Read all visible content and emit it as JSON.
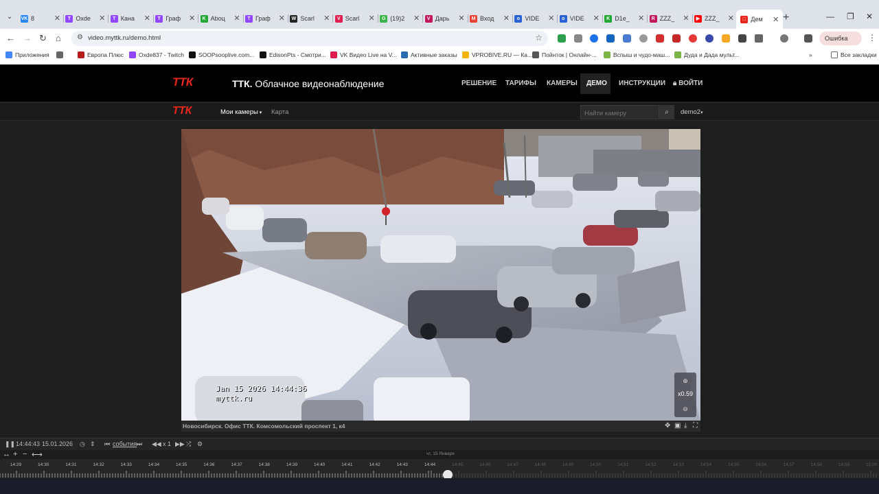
{
  "browser": {
    "tabs": [
      {
        "label": "8",
        "fav": "VK",
        "color": "#2787f5"
      },
      {
        "label": "Oxdе",
        "fav": "T",
        "color": "#9146ff"
      },
      {
        "label": "Кана",
        "fav": "T",
        "color": "#9146ff"
      },
      {
        "label": "Граф",
        "fav": "T",
        "color": "#9146ff"
      },
      {
        "label": "Aboц",
        "fav": "K",
        "color": "#22a833"
      },
      {
        "label": "Граф",
        "fav": "T",
        "color": "#9146ff"
      },
      {
        "label": "Scarl",
        "fav": "W",
        "color": "#222"
      },
      {
        "label": "Scarl",
        "fav": "V",
        "color": "#e01b4f"
      },
      {
        "label": "(19)2",
        "fav": "G",
        "color": "#3bb54a"
      },
      {
        "label": "Дарь",
        "fav": "V",
        "color": "#c2185b"
      },
      {
        "label": "Вход",
        "fav": "M",
        "color": "#ea4335"
      },
      {
        "label": "VIDE",
        "fav": "o",
        "color": "#2a62d5"
      },
      {
        "label": "VIDE",
        "fav": "o",
        "color": "#2a62d5"
      },
      {
        "label": "D1e_",
        "fav": "K",
        "color": "#22a833"
      },
      {
        "label": "ZZZ_",
        "fav": "R",
        "color": "#c2185b"
      },
      {
        "label": "ZZZ_",
        "fav": "▶",
        "color": "#ff0000"
      },
      {
        "label": "Дем",
        "fav": "□",
        "color": "#e8261c"
      }
    ],
    "url": "video.myttk.ru/demo.html",
    "error_button": "Ошибка",
    "bookmarks": [
      {
        "label": "Приложения",
        "color": "#4285f4"
      },
      {
        "label": "",
        "color": "#666"
      },
      {
        "label": "Европа Плюс",
        "color": "#b71c1c"
      },
      {
        "label": "Oxde837 - Twitch",
        "color": "#9146ff"
      },
      {
        "label": "SOOPsooplive.com...",
        "color": "#111"
      },
      {
        "label": "EdisonPts - Смотри...",
        "color": "#111"
      },
      {
        "label": "VK Видео Live на V...",
        "color": "#e01b4f"
      },
      {
        "label": "Активные заказы",
        "color": "#2b6cb0"
      },
      {
        "label": "VPROBIVE.RU — Ка...",
        "color": "#f4b400"
      },
      {
        "label": "Пойнток | Онлайн-...",
        "color": "#555"
      },
      {
        "label": "Вспыш и чудо-маш...",
        "color": "#7cb342"
      },
      {
        "label": "Дуда и Дада мульт...",
        "color": "#7cb342"
      }
    ],
    "all_bookmarks": "Все закладки"
  },
  "site": {
    "logo": "ТТК",
    "title_bold": "ТТК.",
    "title_rest": " Облачное видеонаблюдение",
    "nav": {
      "solution": "РЕШЕНИЕ",
      "tariffs": "ТАРИФЫ",
      "cameras": "КАМЕРЫ",
      "demo": "ДЕМО",
      "instructions": "ИНСТРУКЦИИ",
      "login": "ВОЙТИ"
    },
    "subnav": {
      "my_cameras": "Мои камеры",
      "map": "Карта",
      "search_placeholder": "Найти камеру",
      "user": "demo2"
    }
  },
  "camera": {
    "osd_datetime": "Jan 15 2026 14:44:36",
    "osd_site": "myttk.ru",
    "zoom": "x0.59",
    "caption": "Новосибирск. Офис ТТК. Комсомольский проспект 1, к4"
  },
  "player": {
    "time": "14:44:43",
    "date": "15.01.2026",
    "events": "события",
    "speed": "x 1",
    "day_label": "чт, 15 Января",
    "ticks": [
      "14:29",
      "14:30",
      "14:31",
      "14:32",
      "14:33",
      "14:34",
      "14:35",
      "14:36",
      "14:37",
      "14:38",
      "14:39",
      "14:40",
      "14:41",
      "14:42",
      "14:43",
      "14:44",
      "14:45",
      "14:46",
      "14:47",
      "14:48",
      "14:49",
      "14:50",
      "14:51",
      "14:52",
      "14:53",
      "14:54",
      "14:55",
      "14:56",
      "14:57",
      "14:58",
      "14:59",
      "15:00"
    ],
    "last_past_tick_index": 15,
    "playhead_fraction": 0.66
  },
  "icons": {
    "pause": "pause-icon",
    "clock": "clock-icon",
    "updown": "updown-icon",
    "prev": "prev-event-icon",
    "next": "next-event-icon",
    "rewind": "rewind-icon",
    "forward": "forward-icon",
    "shuffle": "shuffle-icon",
    "settings": "gear-icon"
  }
}
